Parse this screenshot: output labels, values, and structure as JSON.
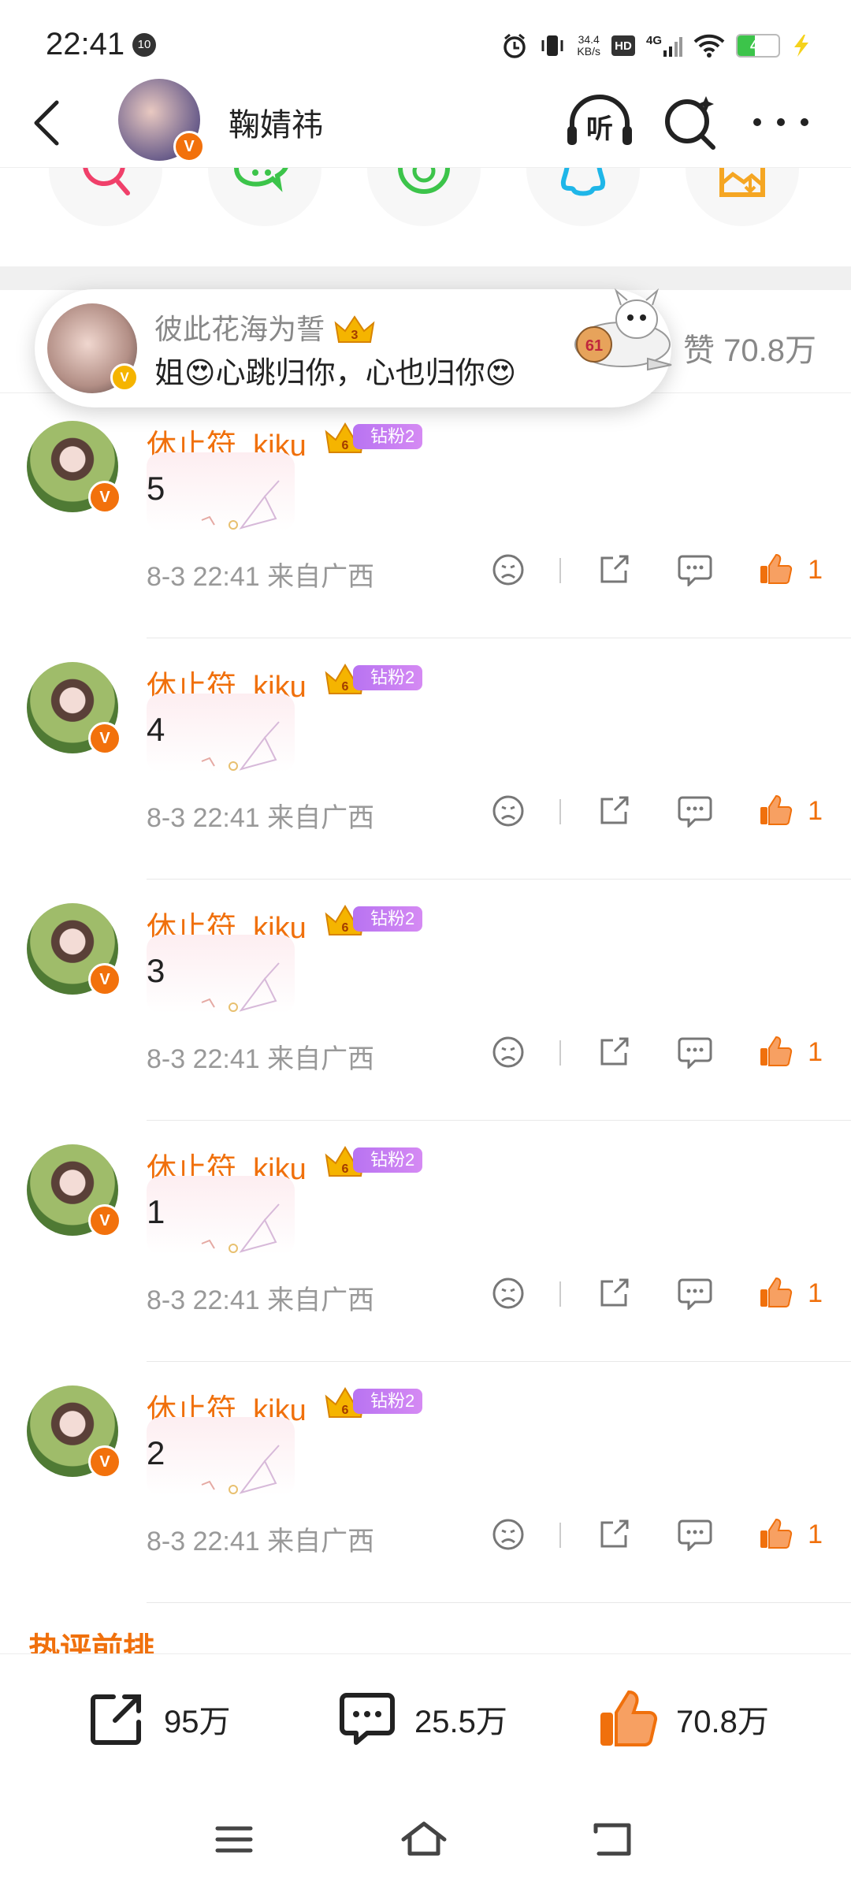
{
  "status_bar": {
    "time": "22:41",
    "badge": "10",
    "net_speed_value": "34.4",
    "net_speed_unit": "KB/s",
    "hd": "HD",
    "network": "4G",
    "battery": "43",
    "battery_level": 0.43
  },
  "header": {
    "username": "鞠婧祎",
    "listen_label": "听"
  },
  "like_line": {
    "text": "赞 70.8万"
  },
  "popup": {
    "name": "彼此花海为誓",
    "crown_level": "3",
    "message": "姐😍心跳归你，心也归你😍",
    "plane_label": "61"
  },
  "comments": [
    {
      "name": "休止符_kiku",
      "crown_level": "6",
      "fan_badge": "钻粉2",
      "text": "5",
      "time": "8-3 22:41  来自广西",
      "likes": "1"
    },
    {
      "name": "休止符_kiku",
      "crown_level": "6",
      "fan_badge": "钻粉2",
      "text": "4",
      "time": "8-3 22:41  来自广西",
      "likes": "1"
    },
    {
      "name": "休止符_kiku",
      "crown_level": "6",
      "fan_badge": "钻粉2",
      "text": "3",
      "time": "8-3 22:41  来自广西",
      "likes": "1"
    },
    {
      "name": "休止符_kiku",
      "crown_level": "6",
      "fan_badge": "钻粉2",
      "text": "1",
      "time": "8-3 22:41  来自广西",
      "likes": "1"
    },
    {
      "name": "休止符_kiku",
      "crown_level": "6",
      "fan_badge": "钻粉2",
      "text": "2",
      "time": "8-3 22:41  来自广西",
      "likes": "1"
    }
  ],
  "section": {
    "hot_title": "热评前排"
  },
  "bottom_bar": {
    "repost_count": "95万",
    "comment_count": "25.5万",
    "like_count": "70.8万"
  },
  "colors": {
    "accent_orange": "#f0700c",
    "fan_badge_purple": "#c27ef2",
    "share_red": "#f0406a",
    "share_green": "#3cc44a",
    "share_cyan": "#1fb6e8",
    "share_yellow": "#f5a623"
  }
}
